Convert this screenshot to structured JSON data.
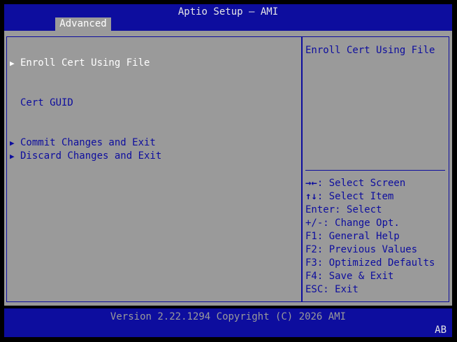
{
  "header": {
    "title": "Aptio Setup – AMI",
    "tab_label": "Advanced"
  },
  "menu": {
    "items": [
      {
        "label": "Enroll Cert Using File",
        "arrow": "▶",
        "selected": true
      },
      {
        "label": "Cert GUID",
        "arrow": ""
      },
      {
        "label": "Commit Changes and Exit",
        "arrow": "▶"
      },
      {
        "label": "Discard Changes and Exit",
        "arrow": "▶"
      }
    ]
  },
  "help": {
    "text": "Enroll Cert Using File",
    "keys": [
      {
        "key": "→←",
        "action": ": Select Screen"
      },
      {
        "key": "↑↓",
        "action": ": Select Item"
      },
      {
        "key": "Enter",
        "action": ": Select"
      },
      {
        "key": "+/-",
        "action": ": Change Opt."
      },
      {
        "key": "F1",
        "action": ": General Help"
      },
      {
        "key": "F2",
        "action": ": Previous Values"
      },
      {
        "key": "F3",
        "action": ": Optimized Defaults"
      },
      {
        "key": "F4",
        "action": ": Save & Exit"
      },
      {
        "key": "ESC",
        "action": ": Exit"
      }
    ]
  },
  "footer": {
    "version": "Version 2.22.1294 Copyright (C) 2026 AMI",
    "corner": "AB"
  },
  "colors": {
    "bios_blue": "#0d0d9e",
    "panel_gray": "#9a9a9a",
    "highlight_white": "#ffffff"
  }
}
